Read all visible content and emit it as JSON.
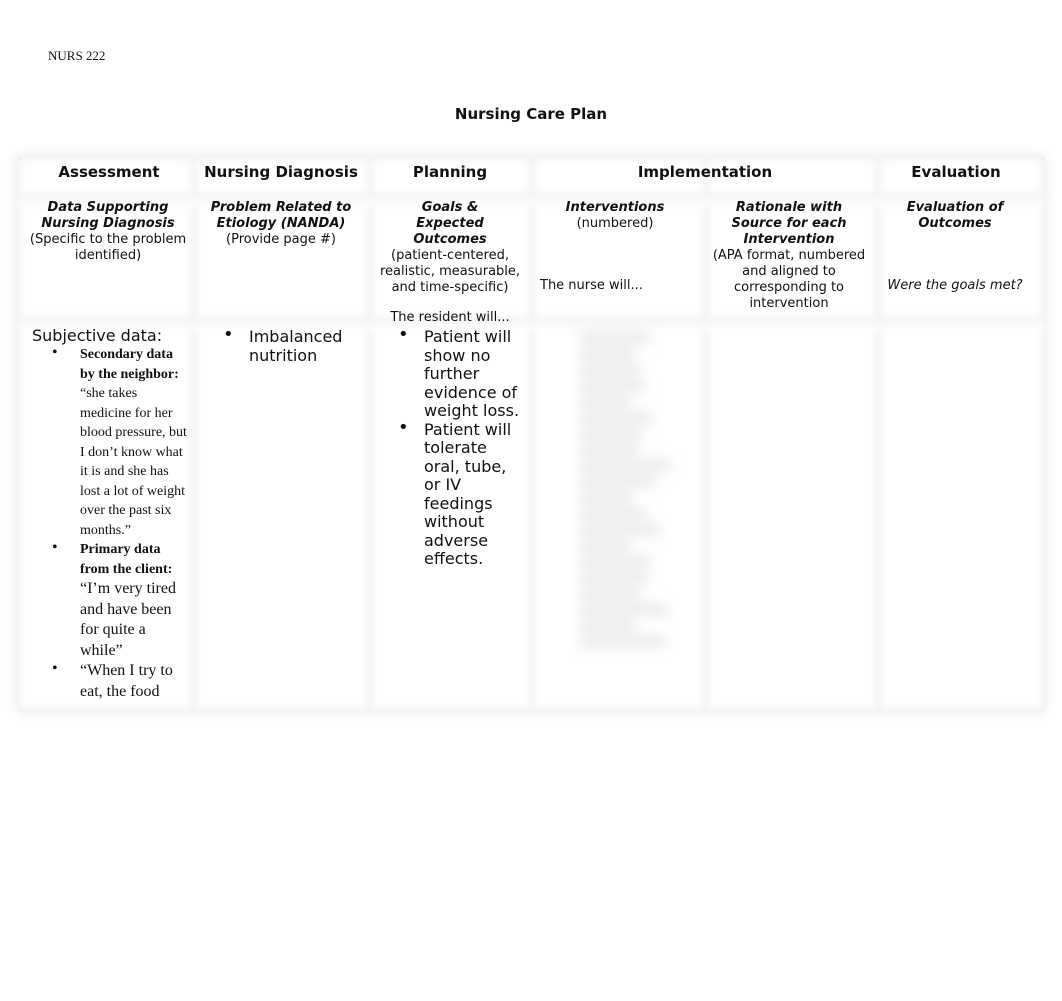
{
  "header": {
    "course": "NURS 222",
    "title": "Nursing Care Plan"
  },
  "columns": {
    "assessment": {
      "title": "Assessment",
      "subtitle": "Data Supporting Nursing Diagnosis",
      "note": "(Specific to the problem identified)"
    },
    "diagnosis": {
      "title": "Nursing Diagnosis",
      "subtitle": "Problem Related to Etiology (NANDA)",
      "note": "(Provide page #)"
    },
    "planning": {
      "title": "Planning",
      "subtitle": "Goals & Expected Outcomes",
      "note": "(patient-centered, realistic, measurable, and time-specific)",
      "prompt": "The resident will..."
    },
    "implementation": {
      "title": "Implementation",
      "interventions": {
        "subtitle": "Interventions",
        "note": "(numbered)",
        "prompt": "The nurse will..."
      },
      "rationale": {
        "subtitle": "Rationale with Source for each Intervention",
        "note": "(APA format, numbered and aligned to corresponding to intervention"
      }
    },
    "evaluation": {
      "title": "Evaluation",
      "subtitle": "Evaluation of Outcomes",
      "prompt": "Were the goals met?"
    }
  },
  "content": {
    "assessment": {
      "label": "Subjective data:",
      "items": [
        {
          "bold": "Secondary data by the neighbor:",
          "text": "“she takes medicine for her blood pressure, but I don’t know what it is and she has lost a lot of weight over the past six months.”"
        },
        {
          "bold": "Primary data from the client:",
          "text": "“I’m very tired and have been for quite a while”"
        },
        {
          "bold": "",
          "text": "“When I try to eat, the food"
        }
      ]
    },
    "diagnosis": {
      "items": [
        "Imbalanced nutrition"
      ]
    },
    "planning": {
      "items": [
        "Patient will show no further evidence of weight loss.",
        "Patient will tolerate oral, tube, or IV feedings without adverse effects."
      ]
    },
    "interventions": {
      "redacted": true
    }
  }
}
